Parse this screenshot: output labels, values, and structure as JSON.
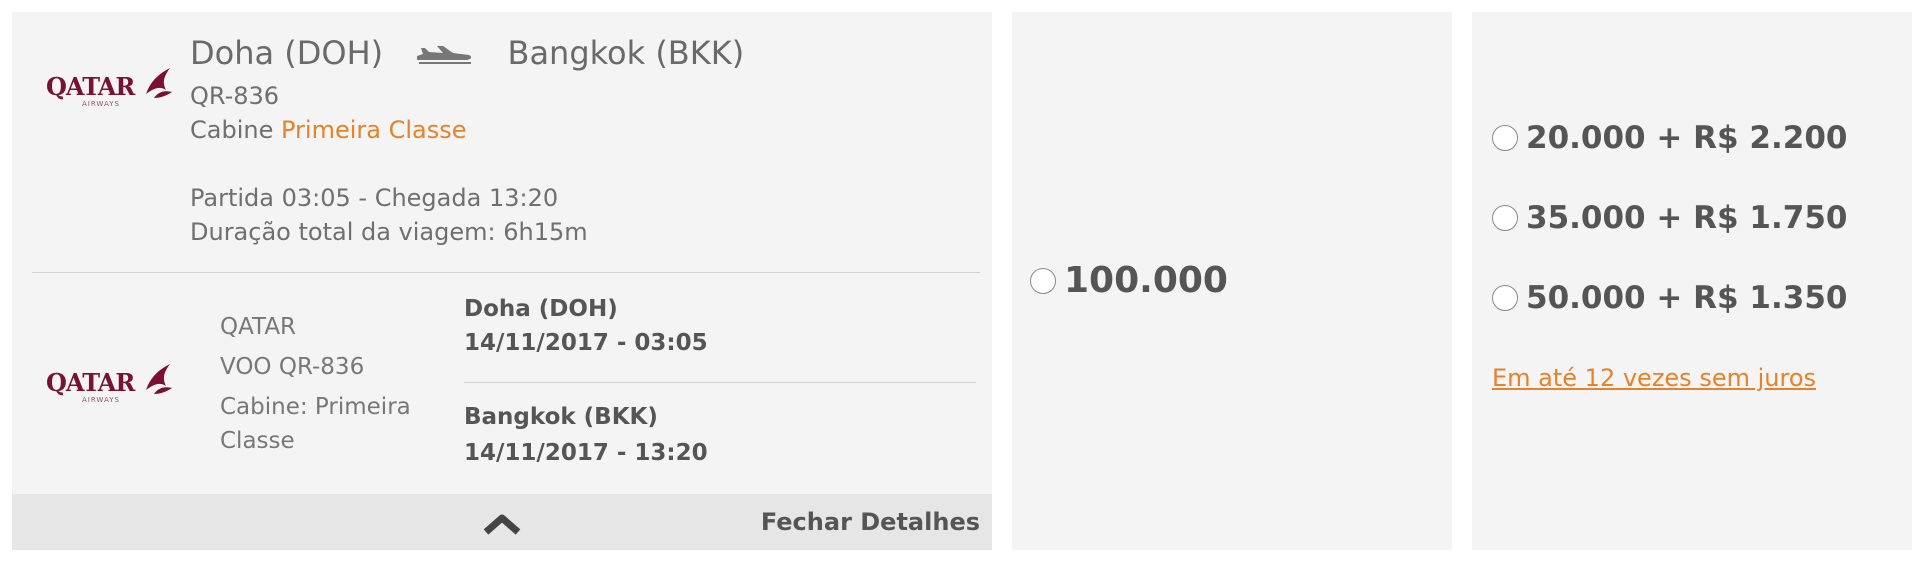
{
  "flight": {
    "airline_logo": "QATAR",
    "airline_logo_sub": "AIRWAYS",
    "origin": "Doha (DOH)",
    "destination": "Bangkok (BKK)",
    "flight_code": "QR-836",
    "cabin_prefix": "Cabine",
    "cabin_class": "Primeira Classe",
    "times": "Partida 03:05 - Chegada 13:20",
    "duration": "Duração total da viagem: 6h15m",
    "segment": {
      "airline": "QATAR",
      "flight": "VOO QR-836",
      "cabin_line1": "Cabine: Primeira",
      "cabin_line2": "Classe",
      "departure_place": "Doha (DOH)",
      "departure_datetime": "14/11/2017 - 03:05",
      "arrival_place": "Bangkok (BKK)",
      "arrival_datetime": "14/11/2017 - 13:20"
    },
    "close_details": "Fechar Detalhes"
  },
  "miles_option": {
    "value": "100.000"
  },
  "mixed_options": [
    {
      "label": "20.000 + R$ 2.200"
    },
    {
      "label": "35.000 + R$ 1.750"
    },
    {
      "label": "50.000 + R$ 1.350"
    }
  ],
  "installments_link": "Em até 12 vezes sem juros",
  "colors": {
    "accent": "#e88228",
    "brand": "#7a1033",
    "panel": "#f4f4f4"
  },
  "icons": [
    "qatar-oryx-logo-icon",
    "plane-icon",
    "chevron-up-icon",
    "radio-icon"
  ]
}
